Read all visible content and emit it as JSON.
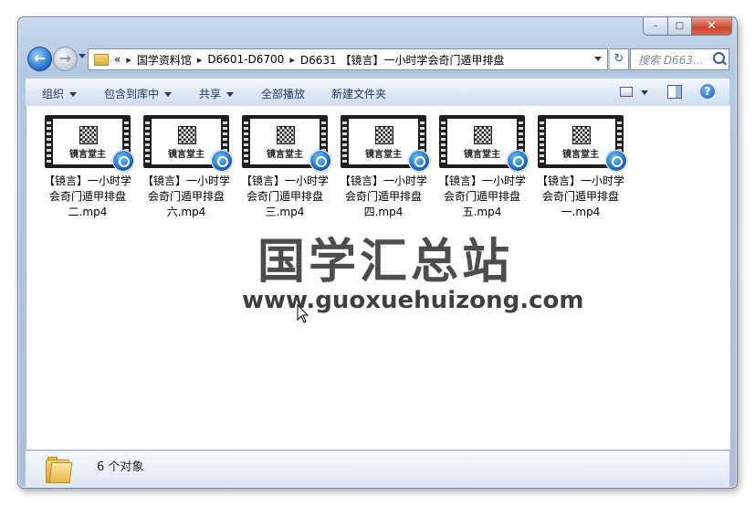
{
  "window": {
    "min_label": "–",
    "max_label": "□",
    "close_label": "✕"
  },
  "nav": {
    "back_glyph": "←",
    "forward_glyph": "→",
    "breadcrumb_overflow": "«",
    "breadcrumb": [
      "国学资料馆",
      "D6601-D6700",
      "D6631 【镜言】一小时学会奇门遁甲排盘"
    ],
    "refresh_glyph": "↻",
    "search_placeholder": "搜索 D663..."
  },
  "toolbar": {
    "organize": "组织",
    "include_in_library": "包含到库中",
    "share": "共享",
    "play_all": "全部播放",
    "new_folder": "新建文件夹"
  },
  "files": [
    {
      "name": "【镜言】一小时学会奇门遁甲排盘二.mp4",
      "thumb_text": "镜言堂主"
    },
    {
      "name": "【镜言】一小时学会奇门遁甲排盘六.mp4",
      "thumb_text": "镜言堂主"
    },
    {
      "name": "【镜言】一小时学会奇门遁甲排盘三.mp4",
      "thumb_text": "镜言堂主"
    },
    {
      "name": "【镜言】一小时学会奇门遁甲排盘四.mp4",
      "thumb_text": "镜言堂主"
    },
    {
      "name": "【镜言】一小时学会奇门遁甲排盘五.mp4",
      "thumb_text": "镜言堂主"
    },
    {
      "name": "【镜言】一小时学会奇门遁甲排盘一.mp4",
      "thumb_text": "镜言堂主"
    }
  ],
  "watermark": {
    "title": "国学汇总站",
    "url": "www.guoxuehuizong.com"
  },
  "details": {
    "count_text": "6 个对象"
  },
  "colors": {
    "accent": "#1e5fb4",
    "close": "#c7462d",
    "folder": "#e7b84a"
  }
}
